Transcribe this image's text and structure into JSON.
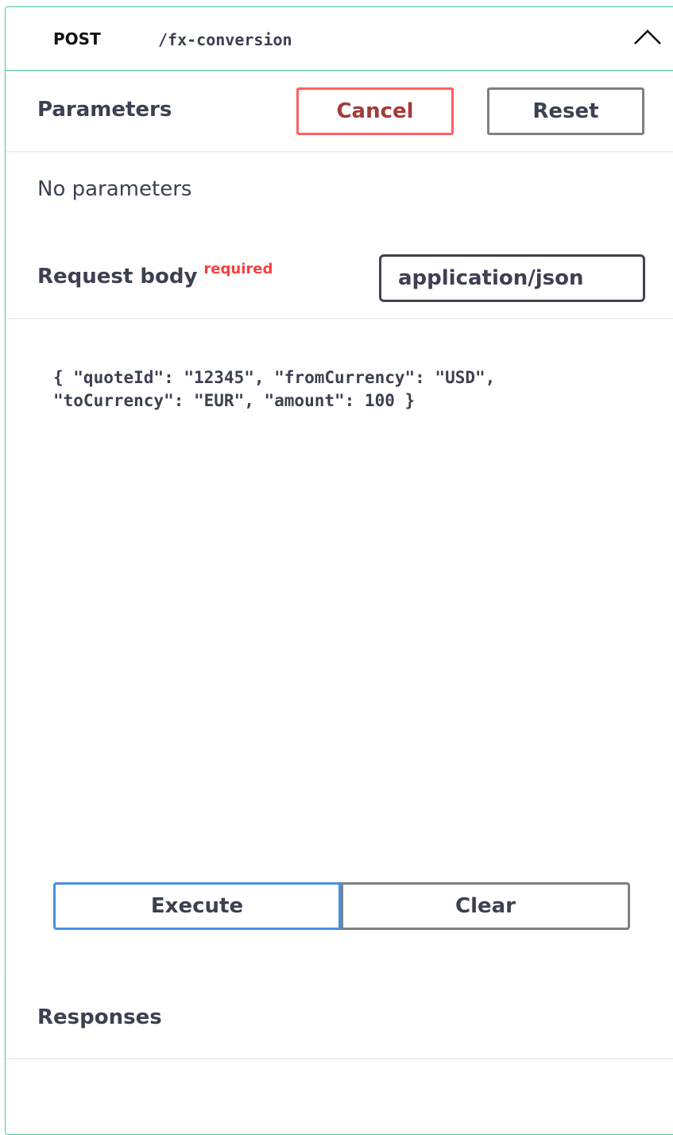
{
  "summary": {
    "method": "POST",
    "path": "/fx-conversion",
    "collapse_icon": "chevron-up-icon"
  },
  "parameters": {
    "title": "Parameters",
    "cancel_label": "Cancel",
    "reset_label": "Reset",
    "empty_text": "No parameters"
  },
  "request_body": {
    "title": "Request body",
    "required_label": "required",
    "content_type": "application/json",
    "body_text": "{ \"quoteId\": \"12345\", \"fromCurrency\": \"USD\",\n\"toCurrency\": \"EUR\", \"amount\": 100 }"
  },
  "actions": {
    "execute_label": "Execute",
    "clear_label": "Clear"
  },
  "responses": {
    "title": "Responses"
  },
  "colors": {
    "post_accent": "#49cc90",
    "cancel_border": "#ff6060",
    "required_text": "#f93e3e",
    "execute_border": "#4990e2"
  }
}
